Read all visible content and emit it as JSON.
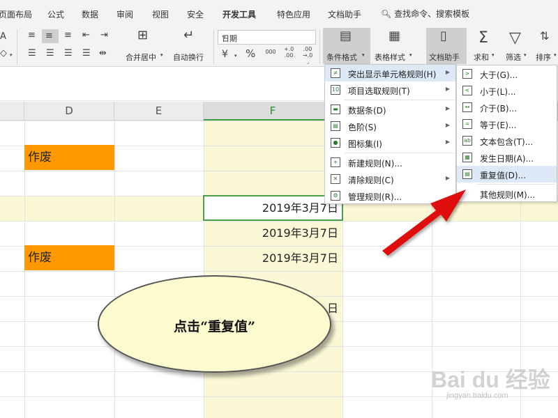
{
  "menubar": {
    "tabs": [
      "页面布局",
      "公式",
      "数据",
      "审阅",
      "视图",
      "安全",
      "开发工具",
      "特色应用",
      "文档助手"
    ],
    "search": "查找命令、搜索模板"
  },
  "ribbon": {
    "format_combo": "日期",
    "merge_label": "合并居中",
    "wrap_label": "自动换行",
    "conditional_format_label": "条件格式",
    "table_style_label": "表格样式",
    "doc_assistant_label": "文档助手",
    "sum_label": "求和",
    "filter_label": "筛选",
    "sort_label": "排序",
    "percent_glyph": "%",
    "thousands_glyph": "000",
    "inc_decimal_glyph": "+.0 .00",
    "dec_decimal_glyph": ".00 →.0"
  },
  "sheet": {
    "columns": [
      "D",
      "E",
      "F"
    ],
    "active_column": "F",
    "orange_cells": [
      "作废",
      "作废"
    ],
    "date_cells": [
      "2019年3月7日",
      "2019年3月7日",
      "2019年3月7日",
      "日"
    ]
  },
  "cf_menu": {
    "items": [
      {
        "label": "突出显示单元格规则(H)",
        "submenu": true,
        "hover": true
      },
      {
        "label": "项目选取规则(T)",
        "submenu": true
      },
      {
        "label": "数据条(D)",
        "submenu": true
      },
      {
        "label": "色阶(S)",
        "submenu": true
      },
      {
        "label": "图标集(I)",
        "submenu": true
      },
      {
        "label": "新建规则(N)..."
      },
      {
        "label": "清除规则(C)",
        "submenu": true
      },
      {
        "label": "管理规则(R)..."
      }
    ]
  },
  "highlight_menu": {
    "items": [
      {
        "label": "大于(G)..."
      },
      {
        "label": "小于(L)..."
      },
      {
        "label": "介于(B)..."
      },
      {
        "label": "等于(E)..."
      },
      {
        "label": "文本包含(T)..."
      },
      {
        "label": "发生日期(A)..."
      },
      {
        "label": "重复值(D)...",
        "hover": true
      },
      {
        "label": "其他规则(M)..."
      }
    ]
  },
  "callout": {
    "text": "点击“重复值”"
  },
  "watermark": {
    "line1": "Bai du 经验",
    "line2": "jingyan.baidu.com"
  },
  "colors": {
    "accent_green": "#3e9a3e",
    "orange_fill": "#ff9900",
    "highlight_row": "#fbf8d6",
    "menu_hover": "#dde9f7",
    "arrow_red": "#e01010",
    "callout_fill": "#fcfbcf"
  }
}
